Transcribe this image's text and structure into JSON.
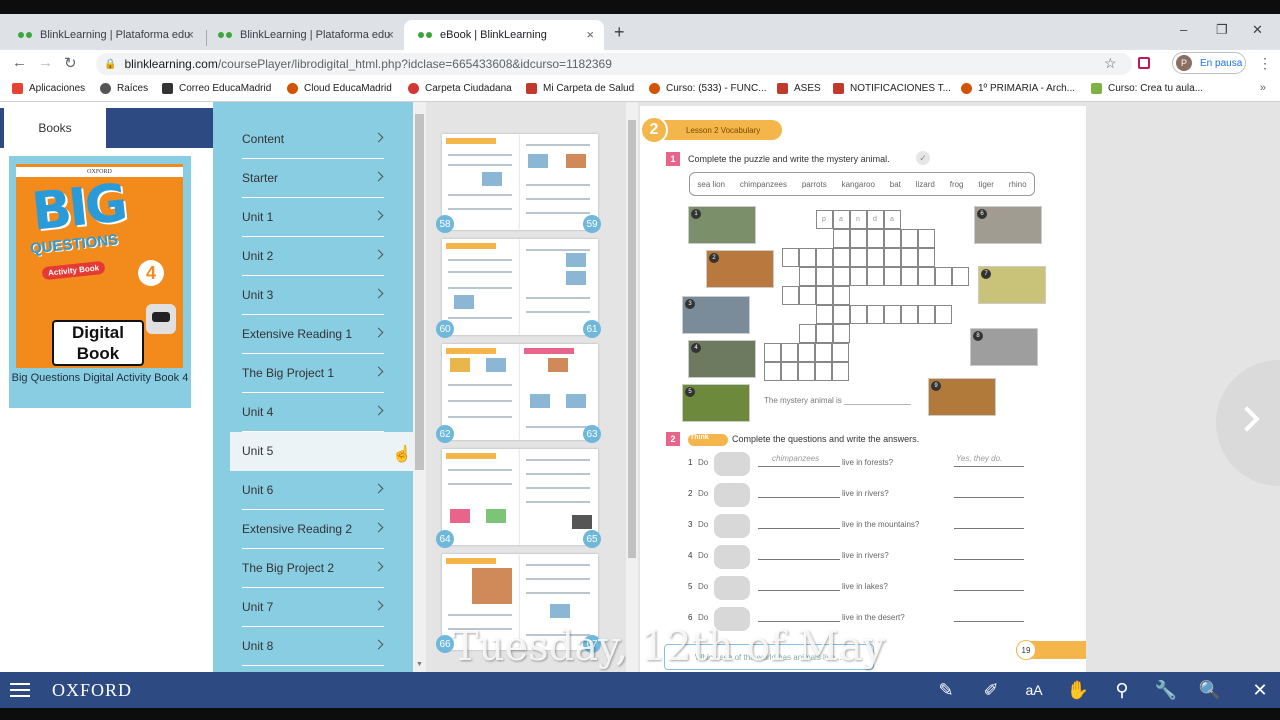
{
  "browser": {
    "tabs": [
      {
        "title": "BlinkLearning | Plataforma educa",
        "close": "×"
      },
      {
        "title": "BlinkLearning | Plataforma educa",
        "close": "×"
      },
      {
        "title": "eBook | BlinkLearning",
        "close": "×"
      }
    ],
    "new_tab": "+",
    "window_controls": {
      "minimize": "–",
      "maximize": "❐",
      "close": "✕"
    },
    "nav": {
      "back": "←",
      "forward": "→",
      "reload": "↻"
    },
    "url_host": "blinklearning.com",
    "url_path": "/coursePlayer/librodigital_html.php?idclase=665433608&idcurso=1182369",
    "star": "☆",
    "profile": {
      "initial": "P",
      "label": "En pausa"
    },
    "menu": "⋮",
    "bookmarks": [
      {
        "label": "Aplicaciones",
        "color": "#e84235"
      },
      {
        "label": "Raíces",
        "color": "#555555"
      },
      {
        "label": "Correo EducaMadrid",
        "color": "#333333"
      },
      {
        "label": "Cloud EducaMadrid",
        "color": "#d35400"
      },
      {
        "label": "Carpeta Ciudadana",
        "color": "#d33636"
      },
      {
        "label": "Mi Carpeta de Salud",
        "color": "#c0392b"
      },
      {
        "label": "Curso: (533) - FUNC...",
        "color": "#d35400"
      },
      {
        "label": "ASES",
        "color": "#c0392b"
      },
      {
        "label": "NOTIFICACIONES T...",
        "color": "#c0392b"
      },
      {
        "label": "1º PRIMARIA - Arch...",
        "color": "#d35400"
      },
      {
        "label": "Curso: Crea tu aula...",
        "color": "#7cb342"
      }
    ],
    "bookmarks_more": "»"
  },
  "left": {
    "books_tab": "Books",
    "book": {
      "publisher": "OXFORD",
      "cover_title": "BIG",
      "cover_subtitle": "QUESTIONS",
      "cover_badge": "Activity Book",
      "cover_level": "4",
      "cover_digital": "Digital Book",
      "title": "Big Questions Digital Activity Book 4"
    }
  },
  "menu": {
    "items": [
      {
        "label": "Content"
      },
      {
        "label": "Starter"
      },
      {
        "label": "Unit 1"
      },
      {
        "label": "Unit 2"
      },
      {
        "label": "Unit 3"
      },
      {
        "label": "Extensive Reading 1"
      },
      {
        "label": "The Big Project 1"
      },
      {
        "label": "Unit 4"
      },
      {
        "label": "Unit 5"
      },
      {
        "label": "Unit 6"
      },
      {
        "label": "Extensive Reading 2"
      },
      {
        "label": "The Big Project 2"
      },
      {
        "label": "Unit 7"
      },
      {
        "label": "Unit 8"
      }
    ],
    "selected": "Unit 5"
  },
  "thumbnails": {
    "page_numbers": [
      "58",
      "59",
      "60",
      "61",
      "62",
      "63",
      "64",
      "65",
      "66",
      "67"
    ]
  },
  "page": {
    "lesson_number": "2",
    "lesson_label": "Lesson 2 Vocabulary",
    "ex1_number": "1",
    "ex1_instruction": "Complete the puzzle and write the mystery animal.",
    "word_bank": [
      "sea lion",
      "chimpanzees",
      "parrots",
      "kangaroo",
      "bat",
      "lizard",
      "frog",
      "tiger",
      "rhino"
    ],
    "crossword_example": [
      "p",
      "a",
      "n",
      "d",
      "a"
    ],
    "mystery_text": "The mystery animal is _______________",
    "ex2_number": "2",
    "ex2_think": "Think",
    "ex2_instruction": "Complete the questions and write the answers.",
    "questions": [
      {
        "n": "1",
        "do": "Do",
        "blank": "chimpanzees",
        "tail": "live in forests?",
        "answer": "Yes, they do."
      },
      {
        "n": "2",
        "do": "Do",
        "blank": "",
        "tail": "live in rivers?",
        "answer": ""
      },
      {
        "n": "3",
        "do": "Do",
        "blank": "",
        "tail": "live in the mountains?",
        "answer": ""
      },
      {
        "n": "4",
        "do": "Do",
        "blank": "",
        "tail": "live in rivers?",
        "answer": ""
      },
      {
        "n": "5",
        "do": "Do",
        "blank": "",
        "tail": "live in lakes?",
        "answer": ""
      },
      {
        "n": "6",
        "do": "Do",
        "blank": "",
        "tail": "live in the desert?",
        "answer": ""
      }
    ],
    "note_text": "Which sea of the world has animals live...",
    "page_number": "19"
  },
  "overlay": {
    "watermark": "Tuesday, 12th of May"
  },
  "bottombar": {
    "brand": "OXFORD",
    "tools": [
      "✎",
      "✐",
      "aA",
      "✋",
      "⚲",
      "🔧",
      "🔍",
      "✕"
    ]
  },
  "colors": {
    "accent_blue": "#2d4b82",
    "menu_blue": "#89cde3",
    "lesson_orange": "#f4b64a",
    "exercise_pink": "#e9648a"
  }
}
